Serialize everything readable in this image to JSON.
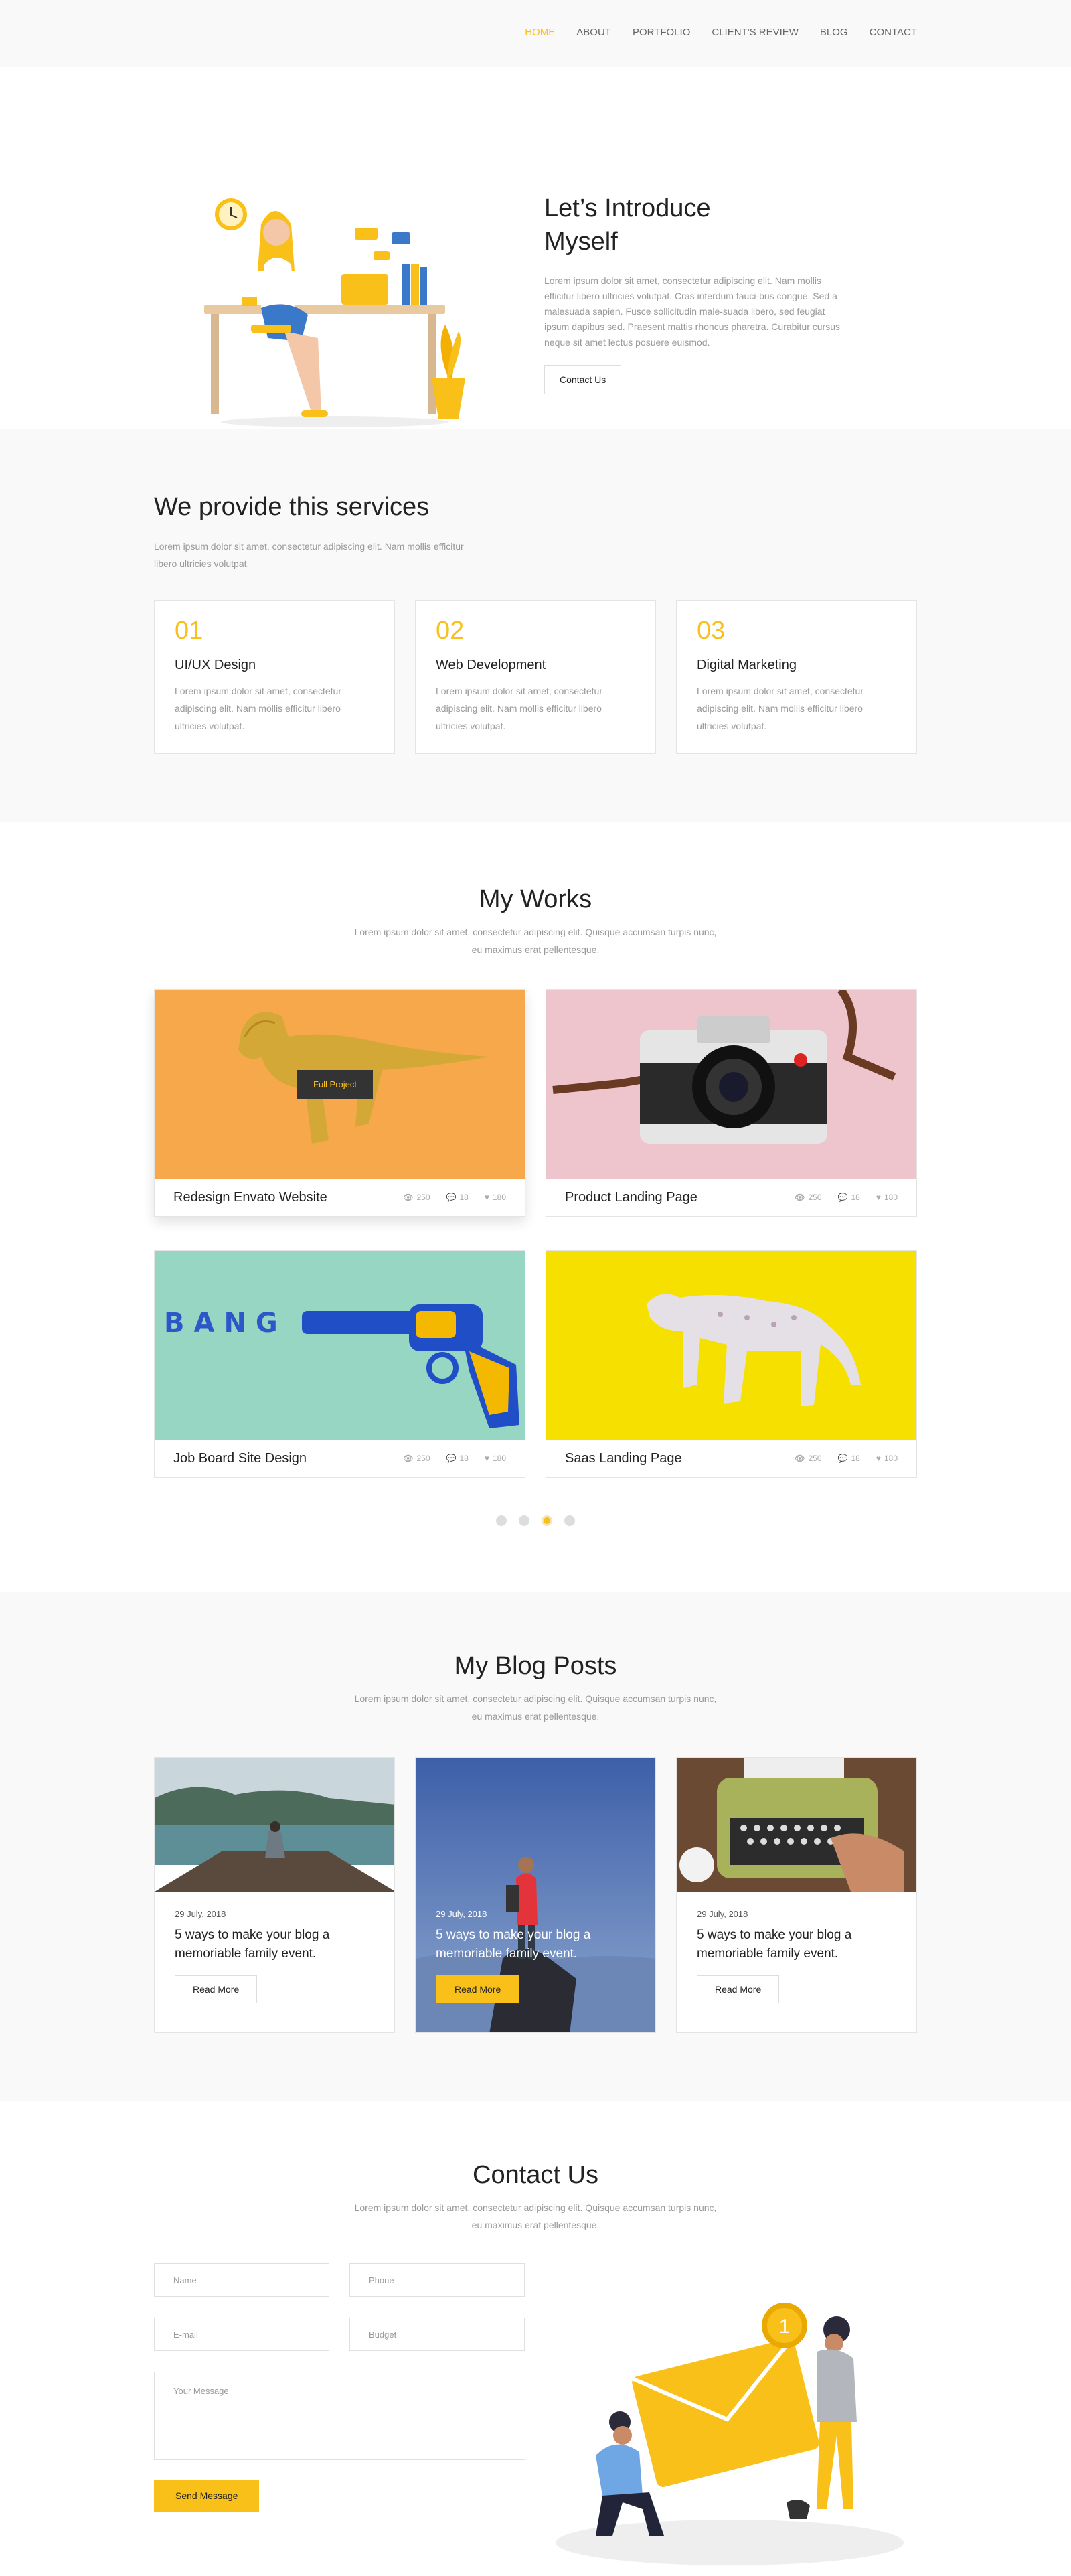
{
  "nav": {
    "items": [
      "HOME",
      "ABOUT",
      "PORTFOLIO",
      "CLIENT'S REVIEW",
      "BLOG",
      "CONTACT"
    ]
  },
  "intro": {
    "title": "Let’s Introduce Myself",
    "text": "Lorem ipsum dolor sit amet, consectetur adipiscing elit. Nam mollis efficitur libero ultricies volutpat. Cras interdum fauci-bus congue. Sed a malesuada sapien. Fusce sollicitudin male-suada libero, sed feugiat ipsum dapibus sed. Praesent mattis rhoncus pharetra. Curabitur cursus neque sit amet lectus posuere euismod.",
    "button": "Contact Us"
  },
  "services": {
    "title": "We provide this services",
    "subtitle": "Lorem ipsum dolor sit amet, consectetur adipiscing elit. Nam mollis efficitur libero ultricies volutpat.",
    "items": [
      {
        "num": "01",
        "title": "UI/UX Design",
        "text": "Lorem ipsum dolor sit amet, consectetur adipiscing elit. Nam mollis efficitur libero ultricies volutpat."
      },
      {
        "num": "02",
        "title": "Web Development",
        "text": "Lorem ipsum dolor sit amet, consectetur adipiscing elit. Nam mollis efficitur libero ultricies volutpat."
      },
      {
        "num": "03",
        "title": "Digital Marketing",
        "text": "Lorem ipsum dolor sit amet, consectetur adipiscing elit. Nam mollis efficitur libero ultricies volutpat."
      }
    ]
  },
  "works": {
    "title": "My Works",
    "subtitle": "Lorem ipsum dolor sit amet, consectetur adipiscing elit. Quisque accumsan turpis nunc, eu maximus erat pellentesque.",
    "full_project": "Full Project",
    "items": [
      {
        "title": "Redesign Envato Website",
        "views": "250",
        "comments": "18",
        "likes": "180",
        "bg": "#f6a84a"
      },
      {
        "title": "Product Landing Page",
        "views": "250",
        "comments": "18",
        "likes": "180",
        "bg": "#eec5cd"
      },
      {
        "title": "Job Board Site Design",
        "views": "250",
        "comments": "18",
        "likes": "180",
        "bg": "#97d6c3"
      },
      {
        "title": "Saas Landing Page",
        "views": "250",
        "comments": "18",
        "likes": "180",
        "bg": "#f5e000"
      }
    ],
    "bang_text": "BANG"
  },
  "blog": {
    "title": "My Blog Posts",
    "subtitle": "Lorem ipsum dolor sit amet, consectetur adipiscing elit. Quisque accumsan turpis nunc, eu maximus erat pellentesque.",
    "posts": [
      {
        "date": "29 July, 2018",
        "title": "5 ways to make your blog a memoriable family event.",
        "button": "Read More"
      },
      {
        "date": "29 July, 2018",
        "title": "5 ways to make your blog a memoriable family event.",
        "button": "Read More"
      },
      {
        "date": "29 July, 2018",
        "title": "5 ways to make your blog a memoriable family event.",
        "button": "Read More"
      }
    ]
  },
  "contact": {
    "title": "Contact Us",
    "subtitle": "Lorem ipsum dolor sit amet, consectetur adipiscing elit. Quisque accumsan turpis nunc, eu maximus erat pellentesque.",
    "name_placeholder": "Name",
    "phone_placeholder": "Phone",
    "email_placeholder": "E-mail",
    "budget_placeholder": "Budget",
    "message_placeholder": "Your Message",
    "button": "Send Message",
    "badge": "1"
  },
  "colors": {
    "accent": "#f8c018",
    "text": "#222222",
    "muted": "#999999",
    "section_bg": "#f9f9f9"
  }
}
